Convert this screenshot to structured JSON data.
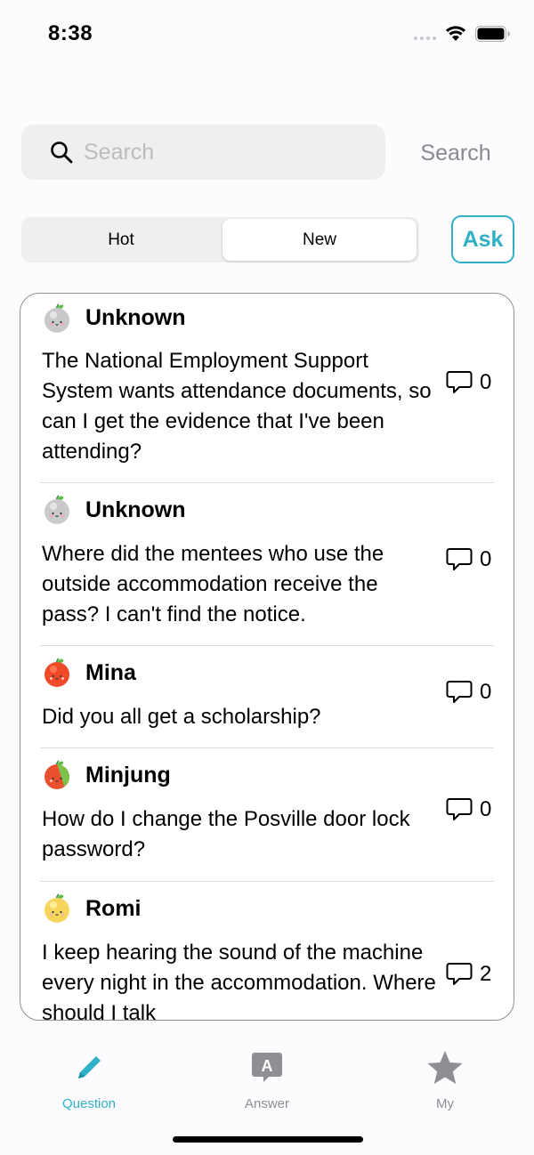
{
  "status_bar": {
    "time": "8:38"
  },
  "search": {
    "placeholder": "Search",
    "value": "",
    "button_label": "Search"
  },
  "segments": {
    "hot_label": "Hot",
    "new_label": "New",
    "selected": "New"
  },
  "ask_label": "Ask",
  "questions": [
    {
      "author": "Unknown",
      "avatar": "gray-apple-icon",
      "text": "The National Employment Support System wants attendance documents, so can I get the evidence that I've been attending?",
      "comments": "0"
    },
    {
      "author": "Unknown",
      "avatar": "gray-apple-icon",
      "text": "Where did the mentees who use the outside accommodation receive the pass? I can't find the notice.",
      "comments": "0"
    },
    {
      "author": "Mina",
      "avatar": "red-apple-icon",
      "text": "Did you all get a scholarship?",
      "comments": "0"
    },
    {
      "author": "Minjung",
      "avatar": "red-green-apple-icon",
      "text": "How do I change the Posville door lock password?",
      "comments": "0"
    },
    {
      "author": "Romi",
      "avatar": "yellow-apple-icon",
      "text": "I keep hearing the sound of the machine every night in the accommodation. Where should I talk",
      "comments": "2"
    }
  ],
  "tabs": [
    {
      "label": "Question",
      "icon": "pencil-icon",
      "active": true
    },
    {
      "label": "Answer",
      "icon": "answer-bubble-icon",
      "active": false
    },
    {
      "label": "My",
      "icon": "star-icon",
      "active": false
    }
  ],
  "colors": {
    "accent": "#30b0c7",
    "inactive": "#8e8e93"
  }
}
